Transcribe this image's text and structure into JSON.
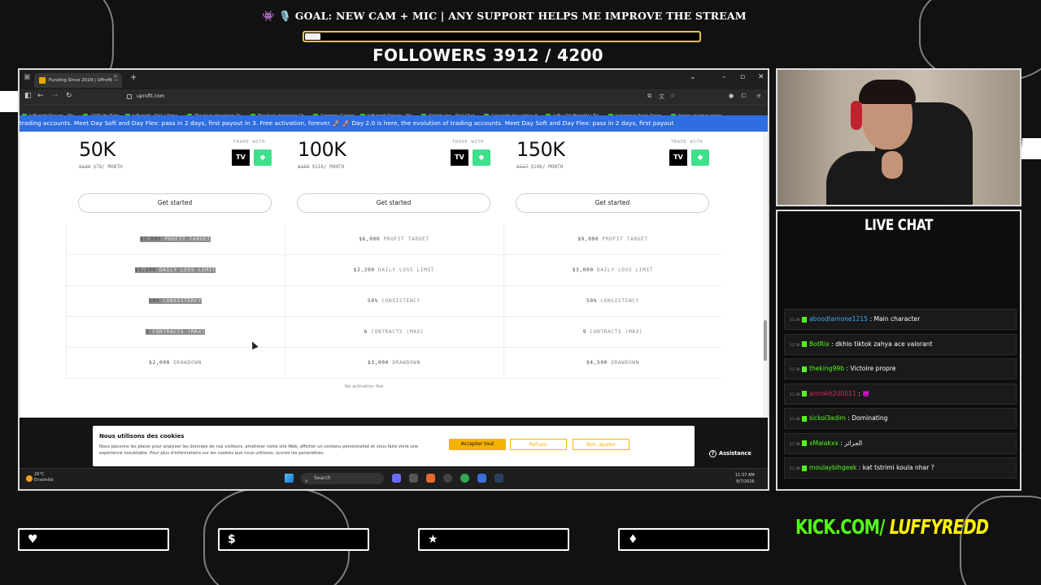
{
  "overlay": {
    "goal_text": "👾 🎙️ GOAL: NEW CAM + MIC | ANY SUPPORT HELPS ME IMPROVE THE STREAM",
    "goal_progress": 0.04,
    "followers_text": "FOLLOWERS 3912 / 4200",
    "live_chat_title": "LIVE CHAT",
    "kick_green": "KICK.COM/",
    "kick_yellow": "LUFFYREDD",
    "bottom_icons": [
      "heart-icon",
      "dollar-icon",
      "star-icon",
      "drop-icon"
    ],
    "bottom_symbols": [
      "♥",
      "$",
      "★",
      "♦"
    ]
  },
  "browser": {
    "tab_title": "Funding Since 2019 | UProfit — ",
    "tab_close": "×",
    "new_tab": "+",
    "url": "uprofit.com",
    "bookmarks": [
      "luffyredd Stream - Wa...",
      "(100) YouTube",
      "luffyredd - Kick | Strea...",
      "The best streaming Ch...",
      "The best streaming Ch...",
      "Comptes Google",
      "luffyredd Stream - Wa...",
      "Kicklet.app - Kick Chat...",
      "Convertir des vidéos Y...",
      "luffy (@luffyredd) | Tik...",
      "Instagram Reels Down...",
      "Autres marque-pages"
    ],
    "banner_text": "trading accounts. Meet Day Soft and Day Flex: pass in 2 days, first payout in 3. Free activation, forever. 🚀    🚀 Day 2.0 is here, the evolution of trading accounts. Meet Day Soft and Day Flex: pass in 2 days, first payout"
  },
  "plans": [
    {
      "size": "50K",
      "old_price": "$130",
      "price": "$78/ MONTH",
      "trade_with": "TRADE WITH",
      "button": "Get started",
      "rows": [
        {
          "value": "$3,000",
          "label": "PROFIT TARGET",
          "selected": true
        },
        {
          "value": "$1,100",
          "label": "DAILY LOSS LIMIT",
          "selected": true
        },
        {
          "value": "50%",
          "label": "CONSISTENCY",
          "selected": true
        },
        {
          "value": "3",
          "label": "CONTRACTS (MAX)",
          "selected": true
        },
        {
          "value": "$2,000",
          "label": "DRAWDOWN",
          "selected": false
        }
      ]
    },
    {
      "size": "100K",
      "old_price": "$193",
      "price": "$116/ MONTH",
      "trade_with": "TRADE WITH",
      "button": "Get started",
      "rows": [
        {
          "value": "$6,000",
          "label": "PROFIT TARGET",
          "selected": false
        },
        {
          "value": "$2,200",
          "label": "DAILY LOSS LIMIT",
          "selected": false
        },
        {
          "value": "50%",
          "label": "CONSISTENCY",
          "selected": false
        },
        {
          "value": "6",
          "label": "CONTRACTS (MAX)",
          "selected": false
        },
        {
          "value": "$3,000",
          "label": "DRAWDOWN",
          "selected": false
        }
      ]
    },
    {
      "size": "150K",
      "old_price": "$327",
      "price": "$196/ MONTH",
      "trade_with": "TRADE WITH",
      "button": "Get started",
      "rows": [
        {
          "value": "$9,000",
          "label": "PROFIT TARGET",
          "selected": false
        },
        {
          "value": "$3,000",
          "label": "DAILY LOSS LIMIT",
          "selected": false
        },
        {
          "value": "50%",
          "label": "CONSISTENCY",
          "selected": false
        },
        {
          "value": "9",
          "label": "CONTRACTS (MAX)",
          "selected": false
        },
        {
          "value": "$4,500",
          "label": "DRAWDOWN",
          "selected": false
        }
      ]
    }
  ],
  "no_activation": "No activation fee",
  "cookie": {
    "title": "Nous utilisons des cookies",
    "text": "Nous pouvons les placer pour analyser les données de nos visiteurs, améliorer notre site Web, afficher un contenu personnalisé et vous faire vivre une expérience inoubliable. Pour plus d'informations sur les cookies que nous utilisons, ouvrez les paramètres.",
    "accept": "Accepter tout",
    "refuse": "Refuser",
    "adjust": "Non, ajuster",
    "assistance": "Assistance"
  },
  "taskbar": {
    "temp": "26°C",
    "weather": "Ensoleillé",
    "search": "Search",
    "time": "11:37 AM",
    "date": "8/7/2026"
  },
  "chat": [
    {
      "user": "aboodtamone1215",
      "msg": "Main character",
      "color": "#3fa9f5"
    },
    {
      "user": "BotRix",
      "msg": "dkhlo tiktok zahya ace valorant",
      "color": "#53fc18"
    },
    {
      "user": "theking99b",
      "msg": "Victoire propre",
      "color": "#53fc18"
    },
    {
      "user": "amrokh200011",
      "msg": "👿",
      "color": "#e0245e"
    },
    {
      "user": "sickol3adim",
      "msg": "Dominating",
      "color": "#53fc18"
    },
    {
      "user": "xMalakxx",
      "msg": "الجزائر",
      "color": "#53fc18"
    },
    {
      "user": "moulaybihgeek",
      "msg": "kat tstrimi koula nhar ?",
      "color": "#53fc18"
    }
  ],
  "chat_time": "11:36",
  "colors": {
    "kick_green": "#53fc18",
    "banner_blue": "#2f6ee0",
    "cookie_accept": "#f5b301",
    "goal_border": "#e3c15a"
  }
}
